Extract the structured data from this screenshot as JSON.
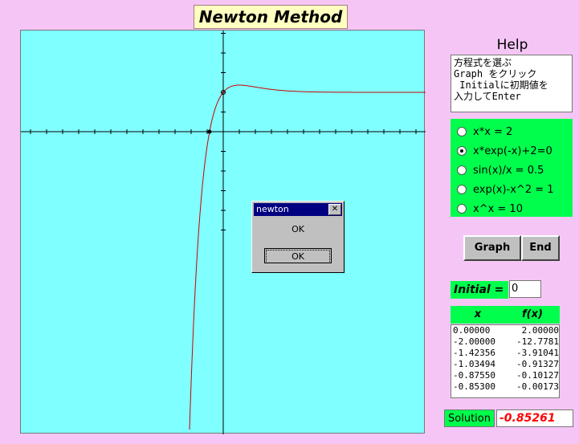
{
  "app": {
    "title": "Newton Method"
  },
  "help": {
    "title": "Help",
    "text": "方程式を選ぶ\nGraph をクリック\n Initialに初期値を\n入力してEnter"
  },
  "equations": [
    {
      "label": "x*x = 2",
      "selected": false
    },
    {
      "label": "x*exp(-x)+2=0",
      "selected": true
    },
    {
      "label": "sin(x)/x = 0.5",
      "selected": false
    },
    {
      "label": "exp(x)-x^2 = 1",
      "selected": false
    },
    {
      "label": "x^x = 10",
      "selected": false
    }
  ],
  "buttons": {
    "graph": "Graph",
    "end": "End"
  },
  "initial": {
    "label": "Initial  =",
    "value": "0"
  },
  "table": {
    "headers": [
      "x",
      "f(x)"
    ],
    "rows": [
      [
        "0.00000",
        "2.00000"
      ],
      [
        "-2.00000",
        "-12.7781"
      ],
      [
        "-1.42356",
        "-3.91041"
      ],
      [
        "-1.03494",
        "-0.91327"
      ],
      [
        "-0.87550",
        "-0.10127"
      ],
      [
        "-0.85300",
        "-0.00173"
      ]
    ]
  },
  "solution": {
    "label": "Solution",
    "value": "-0.85261"
  },
  "dialog": {
    "title": "newton",
    "message": "OK",
    "ok_label": "OK"
  },
  "colors": {
    "background": "#f5c6f5",
    "plot_background": "#7fffff",
    "panel_green": "#00ff4c",
    "curve": "#cc0000",
    "solution_text": "#ff0000"
  }
}
